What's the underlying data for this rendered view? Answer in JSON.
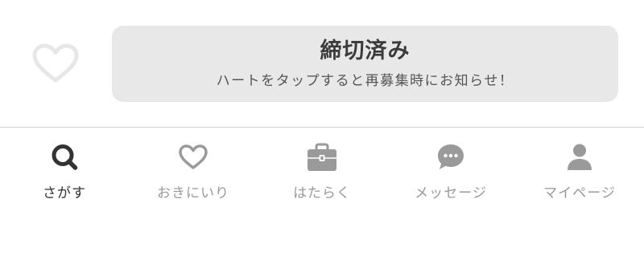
{
  "action_bar": {
    "favorite_icon": "heart-outline-icon",
    "status_title": "締切済み",
    "status_message": "ハートをタップすると再募集時にお知らせ！"
  },
  "tab_bar": {
    "items": [
      {
        "label": "さがす",
        "icon": "search-icon",
        "active": true
      },
      {
        "label": "おきにいり",
        "icon": "heart-icon",
        "active": false
      },
      {
        "label": "はたらく",
        "icon": "briefcase-icon",
        "active": false
      },
      {
        "label": "メッセージ",
        "icon": "chat-bubble-icon",
        "active": false
      },
      {
        "label": "マイページ",
        "icon": "person-icon",
        "active": false
      }
    ]
  },
  "colors": {
    "active_tab": "#333333",
    "inactive_tab": "#9a9a9a",
    "status_box_bg": "#e8e8e8"
  }
}
